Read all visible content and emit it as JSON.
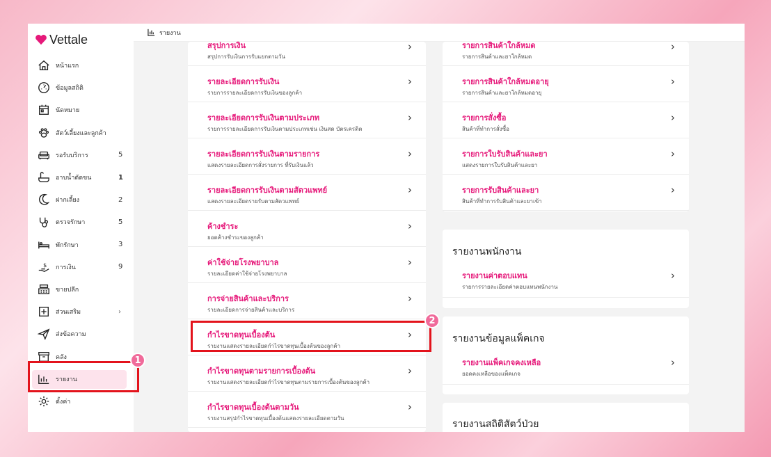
{
  "app": {
    "name": "Vettale",
    "brand_color": "#e6197a"
  },
  "topbar": {
    "title": "รายงาน",
    "icon": "bar-chart-icon"
  },
  "sidebar": {
    "items": [
      {
        "label": "หน้าแรก",
        "icon": "home-icon",
        "count": ""
      },
      {
        "label": "ข้อมูลสถิติ",
        "icon": "dashboard-icon",
        "count": ""
      },
      {
        "label": "นัดหมาย",
        "icon": "calendar-icon",
        "count": ""
      },
      {
        "label": "สัตว์เลี้ยงและลูกค้า",
        "icon": "paw-icon",
        "count": ""
      },
      {
        "label": "รอรับบริการ",
        "icon": "sofa-icon",
        "count": "5"
      },
      {
        "label": "อาบน้ำตัดขน",
        "icon": "bathtub-icon",
        "count": "1"
      },
      {
        "label": "ฝากเลี้ยง",
        "icon": "moon-icon",
        "count": "2"
      },
      {
        "label": "ตรวจรักษา",
        "icon": "stethoscope-icon",
        "count": "5"
      },
      {
        "label": "พักรักษา",
        "icon": "bed-icon",
        "count": "3"
      },
      {
        "label": "การเงิน",
        "icon": "money-hand-icon",
        "count": "9"
      },
      {
        "label": "ขายปลีก",
        "icon": "cash-register-icon",
        "count": ""
      },
      {
        "label": "ส่วนเสริม",
        "icon": "plus-box-icon",
        "count": "›"
      },
      {
        "label": "ส่งข้อความ",
        "icon": "send-icon",
        "count": ""
      },
      {
        "label": "คลัง",
        "icon": "archive-icon",
        "count": ""
      },
      {
        "label": "รายงาน",
        "icon": "bar-chart-icon",
        "count": ""
      },
      {
        "label": "ตั้งค่า",
        "icon": "gear-icon",
        "count": ""
      }
    ]
  },
  "left_card": {
    "rows": [
      {
        "title": "สรุปการเงิน",
        "sub": "สรุปการรับเงินการรับแยกตามวัน"
      },
      {
        "title": "รายละเอียดการรับเงิน",
        "sub": "รายการรายละเอียดการรับเงินของลูกค้า"
      },
      {
        "title": "รายละเอียดการรับเงินตามประเภท",
        "sub": "รายการรายละเอียดการรับเงินตามประเภทเช่น เงินสด บัตรเครดิต"
      },
      {
        "title": "รายละเอียดการรับเงินตามรายการ",
        "sub": "แสดงรายละเอียดการสั่งรายการ ที่รับเงินแล้ว"
      },
      {
        "title": "รายละเอียดการรับเงินตามสัตวแพทย์",
        "sub": "แสดงรายละเอียดรายรับตามสัตวแพทย์"
      },
      {
        "title": "ค้างชำระ",
        "sub": "ยอดค้างชำระของลูกค้า"
      },
      {
        "title": "ค่าใช้จ่ายโรงพยาบาล",
        "sub": "รายละเอียดค่าใช้จ่ายโรงพยาบาล"
      },
      {
        "title": "การจ่ายสินค้าและบริการ",
        "sub": "รายละเอียดการจ่ายสินค้าและบริการ"
      },
      {
        "title": "กำไรขาดทุนเบื้องต้น",
        "sub": "รายงานแสดงรายละเอียดกำไรขาดทุนเบื้องต้นของลูกค้า"
      },
      {
        "title": "กำไรขาดทุนตามรายการเบื้องต้น",
        "sub": "รายงานแสดงรายละเอียดกำไรขาดทุนตามรายการเบื้องต้นของลูกค้า"
      },
      {
        "title": "กำไรขาดทุนเบื้องต้นตามวัน",
        "sub": "รายงานสรุปกำไรขาดทุนเบื้องต้นแสดงรายละเอียดตามวัน"
      }
    ]
  },
  "right_card_1": {
    "rows": [
      {
        "title": "รายการสินค้าใกล้หมด",
        "sub": "รายการสินค้าและยาใกล้หมด"
      },
      {
        "title": "รายการสินค้าใกล้หมดอายุ",
        "sub": "รายการสินค้าและยาใกล้หมดอายุ"
      },
      {
        "title": "รายการสั่งซื้อ",
        "sub": "สินค้าที่ทำการสั่งซื้อ"
      },
      {
        "title": "รายการใบรับสินค้าและยา",
        "sub": "แสดงรายการใบรับสินค้าและยา"
      },
      {
        "title": "รายการรับสินค้าและยา",
        "sub": "สินค้าที่ทำการรับสินค้าและยาเข้า"
      }
    ]
  },
  "right_card_2": {
    "heading": "รายงานพนักงาน",
    "rows": [
      {
        "title": "รายงานค่าตอบแทน",
        "sub": "รายการรายละเอียดค่าตอบแทนพนักงาน"
      }
    ]
  },
  "right_card_3": {
    "heading": "รายงานข้อมูลแพ็คเกจ",
    "rows": [
      {
        "title": "รายงานแพ็คเกจคงเหลือ",
        "sub": "ยอดคงเหลือของแพ็คเกจ"
      }
    ]
  },
  "right_card_4": {
    "heading": "รายงานสถิติสัตว์ป่วย"
  },
  "badges": {
    "one": "1",
    "two": "2"
  },
  "highlight_color": "#e3131c"
}
